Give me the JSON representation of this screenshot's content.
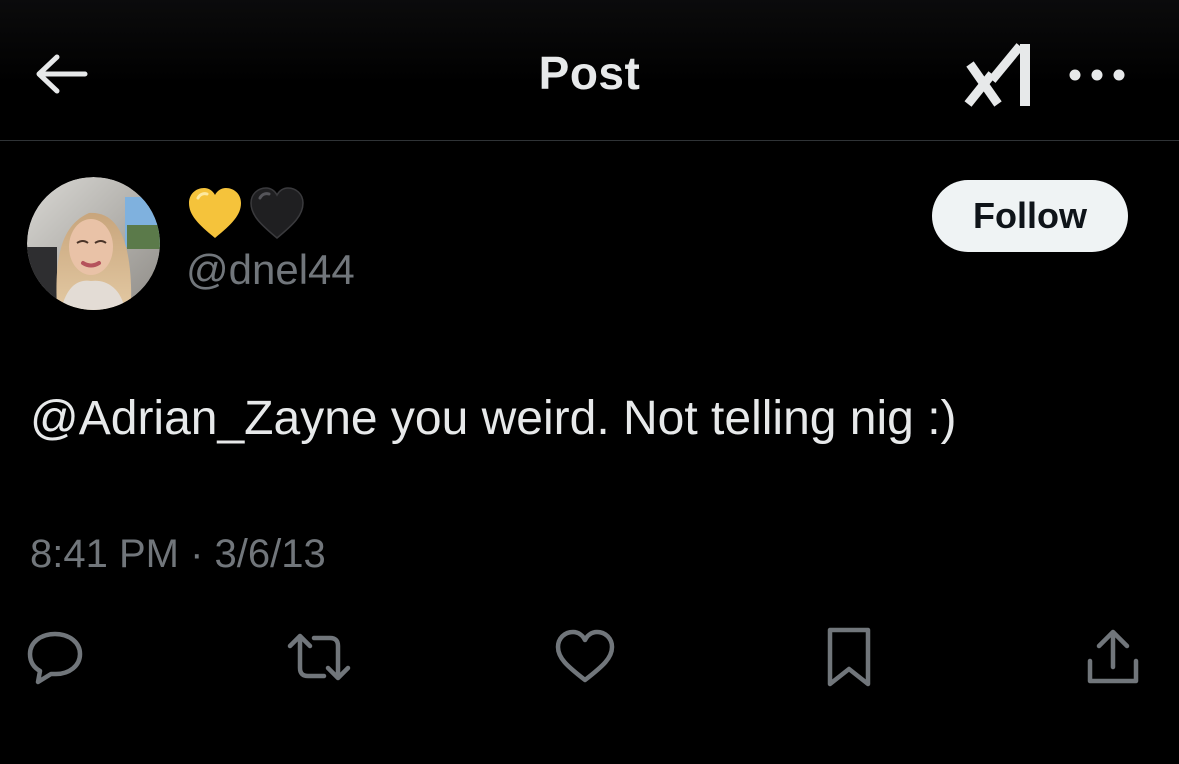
{
  "header": {
    "title": "Post",
    "back_icon": "arrow-left-icon",
    "grok_icon": "grok-icon",
    "more_icon": "more-dots-icon"
  },
  "author": {
    "display_name_emojis": [
      "yellow-heart",
      "black-heart"
    ],
    "handle": "@dnel44",
    "follow_label": "Follow"
  },
  "post": {
    "text": "@Adrian_Zayne you weird. Not telling nig :)",
    "timestamp": "8:41 PM · 3/6/13"
  },
  "actions": [
    {
      "name": "reply",
      "icon": "reply-icon"
    },
    {
      "name": "repost",
      "icon": "repost-icon"
    },
    {
      "name": "like",
      "icon": "heart-icon"
    },
    {
      "name": "bookmark",
      "icon": "bookmark-icon"
    },
    {
      "name": "share",
      "icon": "share-icon"
    }
  ],
  "colors": {
    "background": "#000000",
    "text_primary": "#e7e9ea",
    "text_secondary": "#71767b",
    "divider": "#2f3336",
    "follow_bg": "#eff3f4",
    "yellow_heart": "#f5c33b"
  }
}
